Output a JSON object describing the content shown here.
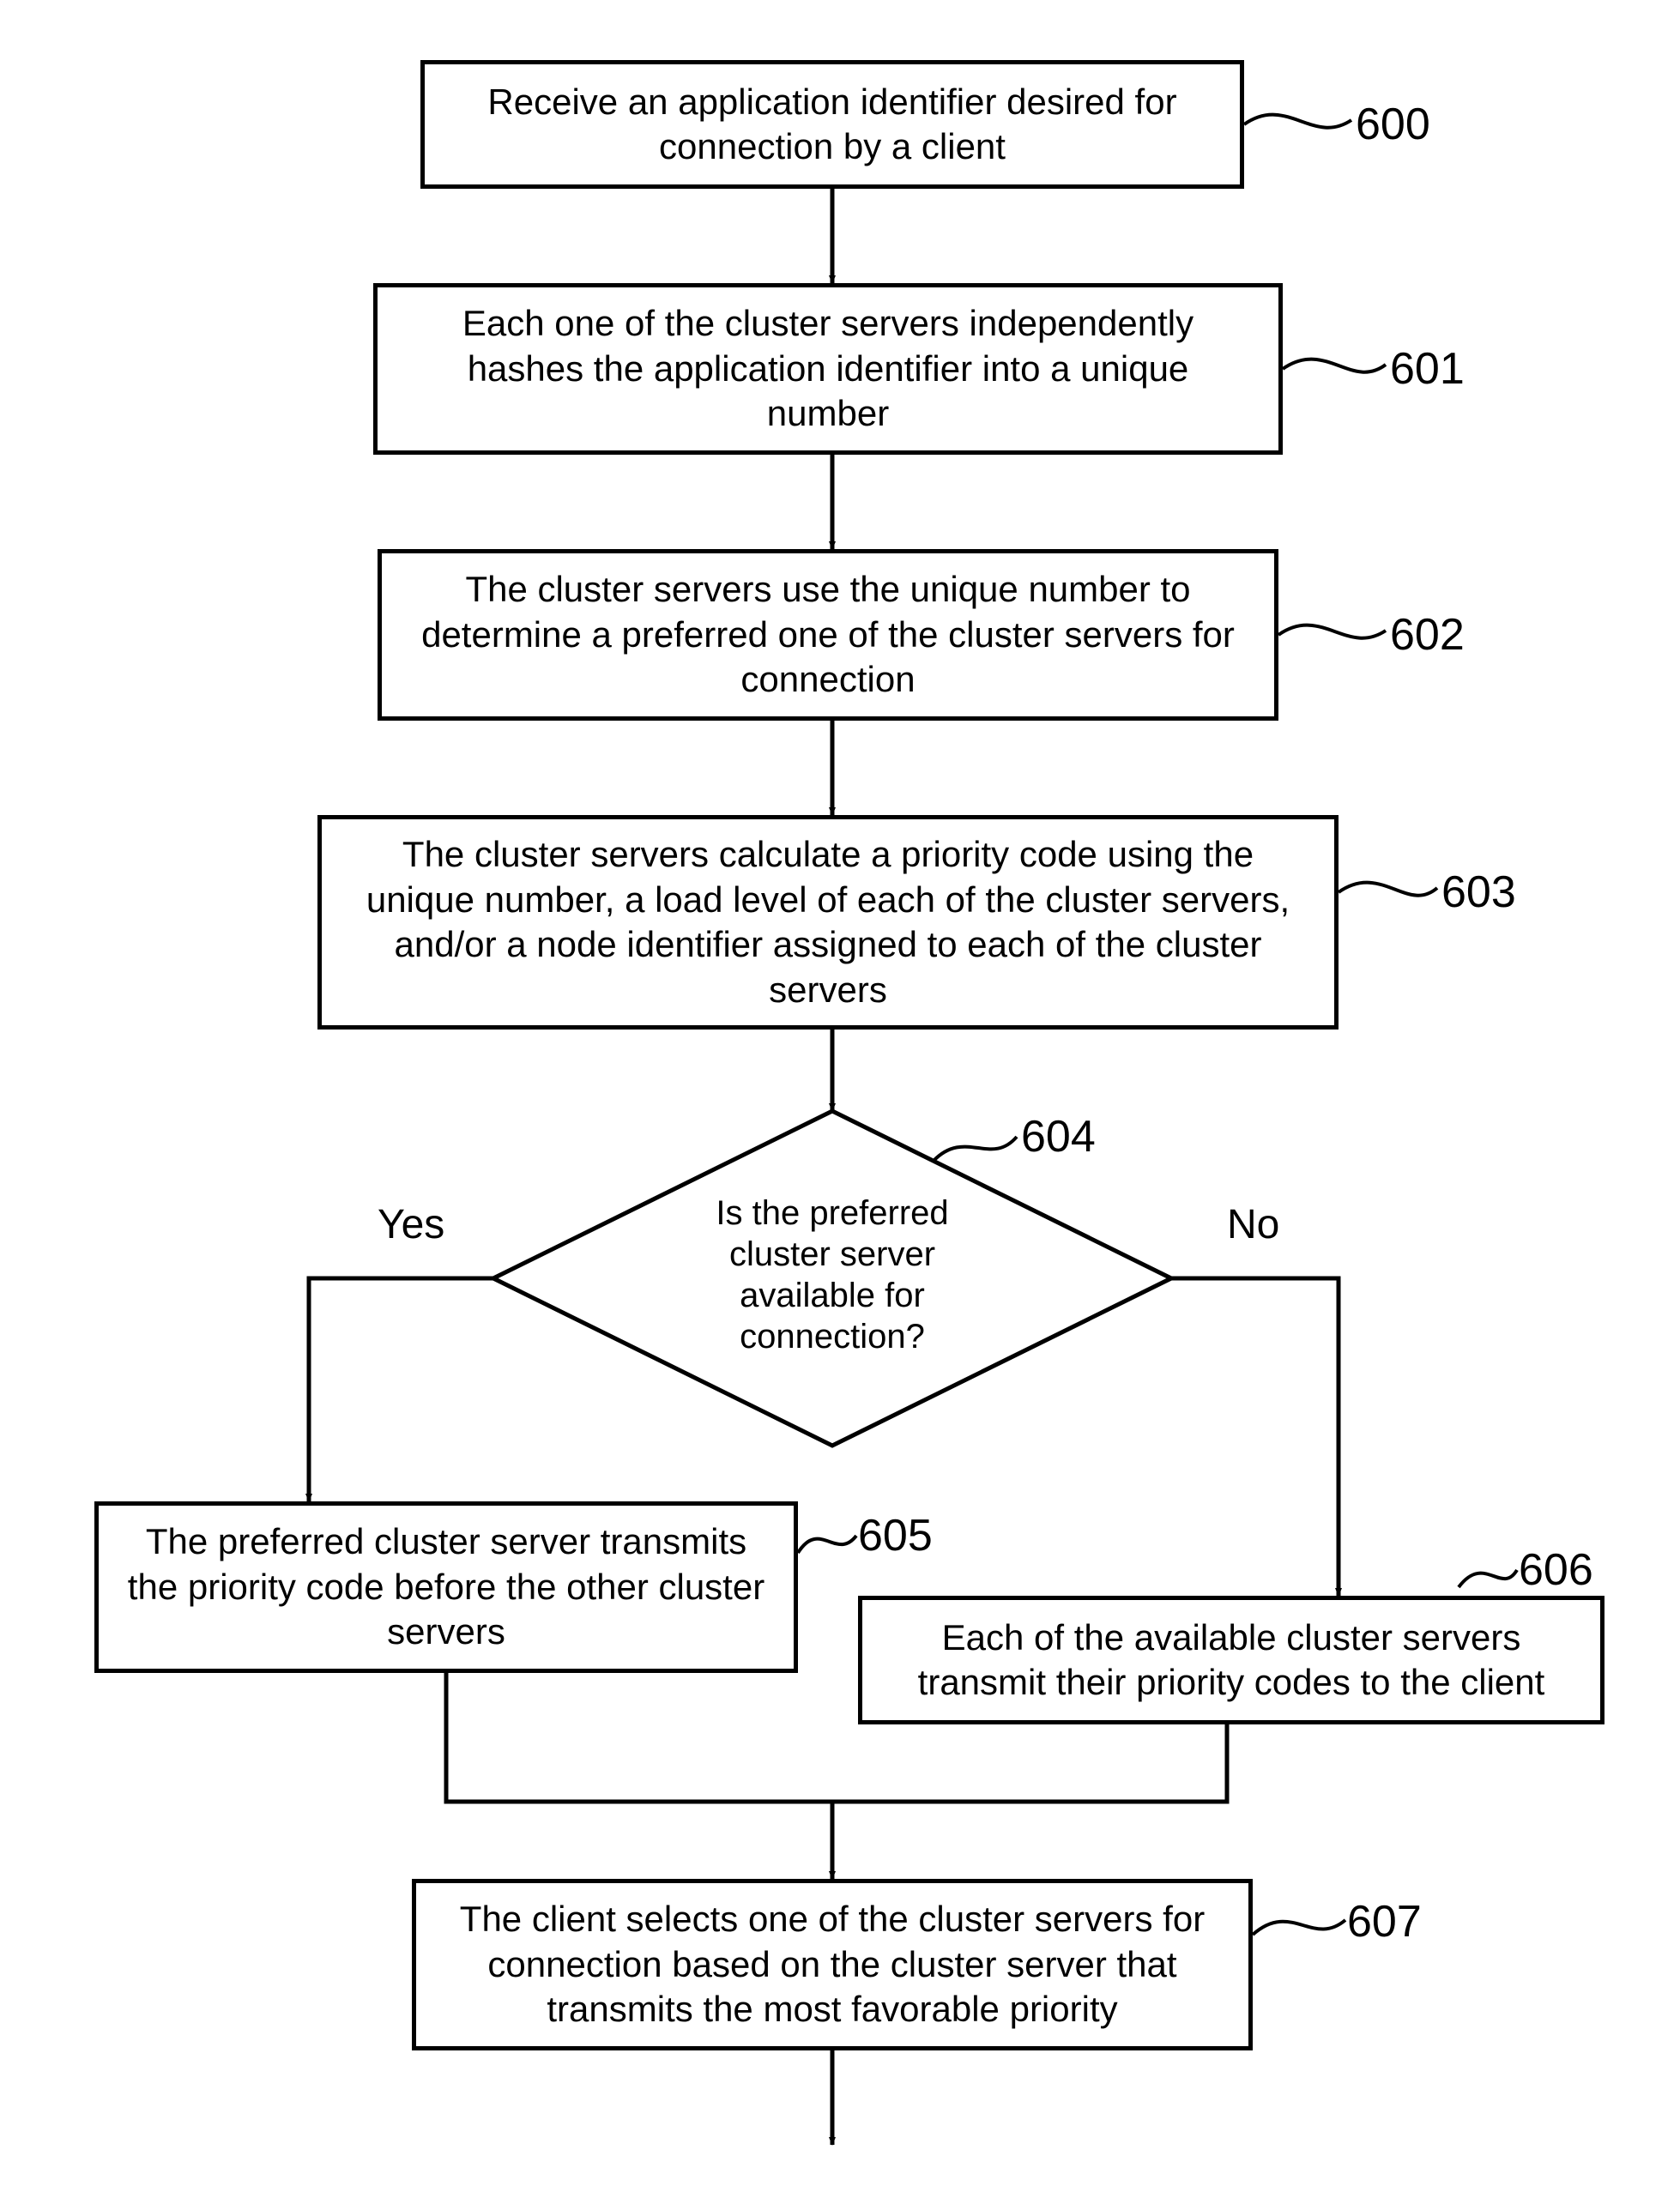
{
  "chart_data": {
    "type": "flowchart",
    "nodes": [
      {
        "id": "600",
        "type": "process",
        "text": "Receive an application identifier desired for connection by a client"
      },
      {
        "id": "601",
        "type": "process",
        "text": "Each one of the cluster servers independently hashes the application identifier into a unique number"
      },
      {
        "id": "602",
        "type": "process",
        "text": "The cluster servers use the unique number to determine a preferred one of the cluster servers for connection"
      },
      {
        "id": "603",
        "type": "process",
        "text": "The cluster servers calculate a priority code using the unique number, a load level of each of the cluster servers, and/or a node identifier assigned to each of the cluster servers"
      },
      {
        "id": "604",
        "type": "decision",
        "text": "Is the preferred cluster server available for connection?"
      },
      {
        "id": "605",
        "type": "process",
        "text": "The preferred cluster server transmits the priority code before the other cluster servers"
      },
      {
        "id": "606",
        "type": "process",
        "text": "Each of the available cluster servers transmit their priority codes to the client"
      },
      {
        "id": "607",
        "type": "process",
        "text": "The client selects one of the cluster servers for connection based on the cluster server that transmits the most favorable priority"
      }
    ],
    "edges": [
      {
        "from": "600",
        "to": "601"
      },
      {
        "from": "601",
        "to": "602"
      },
      {
        "from": "602",
        "to": "603"
      },
      {
        "from": "603",
        "to": "604"
      },
      {
        "from": "604",
        "to": "605",
        "label": "Yes"
      },
      {
        "from": "604",
        "to": "606",
        "label": "No"
      },
      {
        "from": "605",
        "to": "607"
      },
      {
        "from": "606",
        "to": "607"
      },
      {
        "from": "607",
        "to": null
      }
    ]
  },
  "boxes": {
    "b600": "Receive an application identifier desired for connection by a client",
    "b601": "Each one of the cluster servers independently hashes the application identifier into a unique number",
    "b602": "The cluster servers use the unique number to determine a preferred one of the cluster servers for connection",
    "b603": "The cluster servers calculate a priority code using the unique number, a load level of each of the cluster servers, and/or a node identifier assigned to each of the cluster servers",
    "b604": "Is the preferred cluster server available for connection?",
    "b605": "The preferred cluster server transmits the priority code before the other cluster servers",
    "b606": "Each of the available cluster servers transmit their priority codes to the client",
    "b607": "The client selects one of the cluster servers for connection based on the cluster server that transmits the most favorable priority"
  },
  "labels": {
    "l600": "600",
    "l601": "601",
    "l602": "602",
    "l603": "603",
    "l604": "604",
    "l605": "605",
    "l606": "606",
    "l607": "607"
  },
  "branches": {
    "yes": "Yes",
    "no": "No"
  }
}
